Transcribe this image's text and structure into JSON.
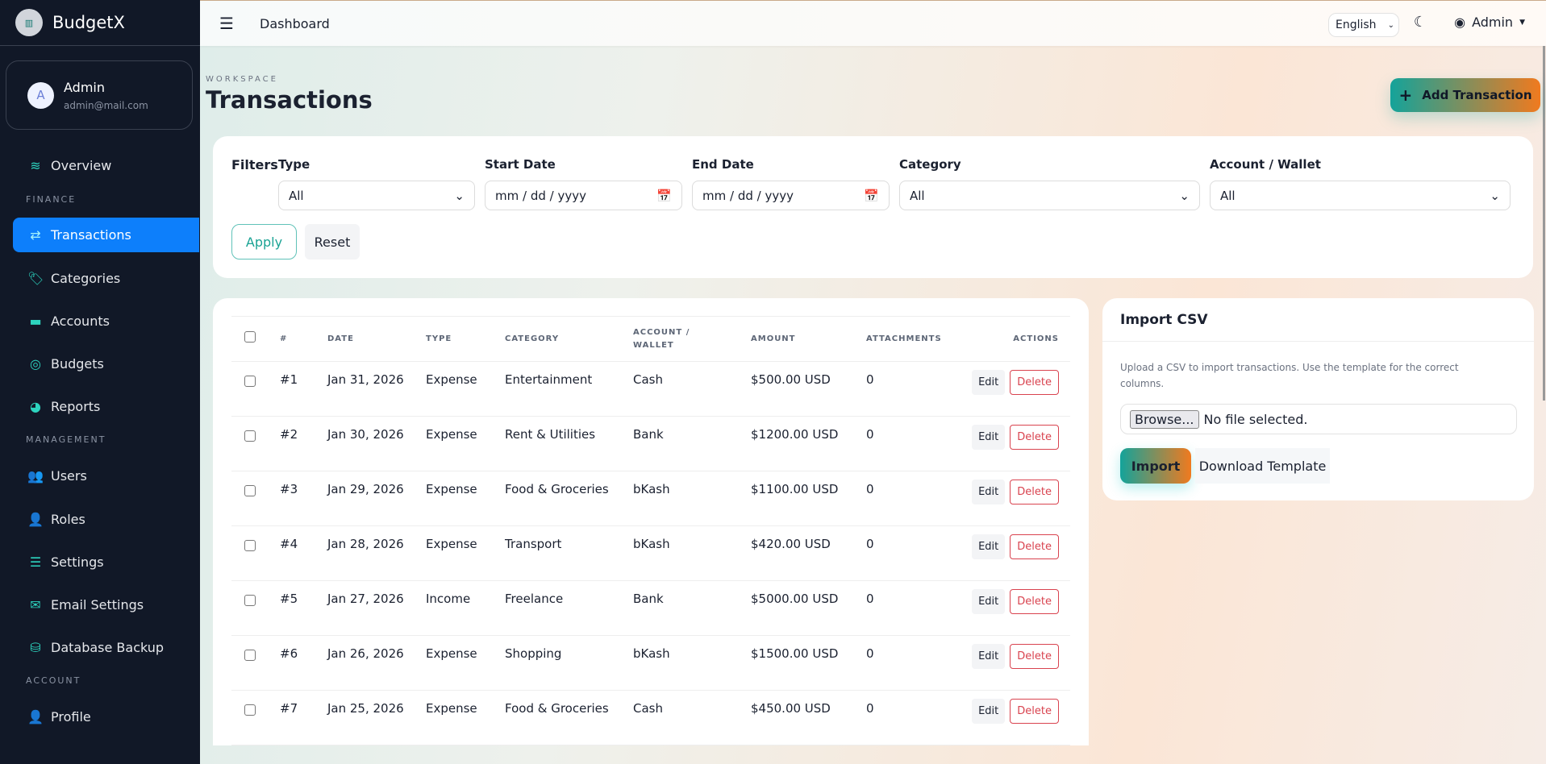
{
  "brand": {
    "name": "BudgetX",
    "logo_text": "BudgetX"
  },
  "profile": {
    "initial": "A",
    "name": "Admin",
    "email": "admin@mail.com"
  },
  "sidebar": {
    "sections": [
      "FINANCE",
      "MANAGEMENT",
      "ACCOUNT"
    ],
    "items": [
      {
        "label": "Overview",
        "icon": "layers-icon"
      },
      {
        "label": "Transactions",
        "icon": "arrows-exchange-icon",
        "active": true
      },
      {
        "label": "Categories",
        "icon": "tags-icon"
      },
      {
        "label": "Accounts",
        "icon": "wallet-icon"
      },
      {
        "label": "Budgets",
        "icon": "target-icon"
      },
      {
        "label": "Reports",
        "icon": "pie-chart-icon"
      },
      {
        "label": "Users",
        "icon": "users-icon"
      },
      {
        "label": "Roles",
        "icon": "user-gear-icon"
      },
      {
        "label": "Settings",
        "icon": "sliders-icon"
      },
      {
        "label": "Email Settings",
        "icon": "envelope-icon"
      },
      {
        "label": "Database Backup",
        "icon": "database-icon"
      },
      {
        "label": "Profile",
        "icon": "user-gear-icon"
      }
    ]
  },
  "topbar": {
    "title": "Dashboard",
    "language": "English",
    "user": "Admin"
  },
  "page": {
    "workspace": "WORKSPACE",
    "title": "Transactions",
    "add_label": "Add Transaction"
  },
  "filters": {
    "heading": "Filters",
    "type_label": "Type",
    "type_value": "All",
    "start_label": "Start Date",
    "start_placeholder": "mm / dd / yyyy",
    "end_label": "End Date",
    "end_placeholder": "mm / dd / yyyy",
    "category_label": "Category",
    "category_value": "All",
    "account_label": "Account / Wallet",
    "account_value": "All",
    "apply": "Apply",
    "reset": "Reset"
  },
  "table": {
    "headers": [
      "#",
      "DATE",
      "TYPE",
      "CATEGORY",
      "ACCOUNT / WALLET",
      "AMOUNT",
      "ATTACHMENTS",
      "ACTIONS"
    ],
    "edit": "Edit",
    "delete": "Delete",
    "rows": [
      {
        "id": "#1",
        "date": "Jan 31, 2026",
        "type": "Expense",
        "category": "Entertainment",
        "account": "Cash",
        "amount": "$500.00 USD",
        "attachments": "0"
      },
      {
        "id": "#2",
        "date": "Jan 30, 2026",
        "type": "Expense",
        "category": "Rent & Utilities",
        "account": "Bank",
        "amount": "$1200.00 USD",
        "attachments": "0"
      },
      {
        "id": "#3",
        "date": "Jan 29, 2026",
        "type": "Expense",
        "category": "Food & Groceries",
        "account": "bKash",
        "amount": "$1100.00 USD",
        "attachments": "0"
      },
      {
        "id": "#4",
        "date": "Jan 28, 2026",
        "type": "Expense",
        "category": "Transport",
        "account": "bKash",
        "amount": "$420.00 USD",
        "attachments": "0"
      },
      {
        "id": "#5",
        "date": "Jan 27, 2026",
        "type": "Income",
        "category": "Freelance",
        "account": "Bank",
        "amount": "$5000.00 USD",
        "attachments": "0"
      },
      {
        "id": "#6",
        "date": "Jan 26, 2026",
        "type": "Expense",
        "category": "Shopping",
        "account": "bKash",
        "amount": "$1500.00 USD",
        "attachments": "0"
      },
      {
        "id": "#7",
        "date": "Jan 25, 2026",
        "type": "Expense",
        "category": "Food & Groceries",
        "account": "Cash",
        "amount": "$450.00 USD",
        "attachments": "0"
      }
    ]
  },
  "import": {
    "title": "Import CSV",
    "description": "Upload a CSV to import transactions. Use the template for the correct columns.",
    "browse": "Browse...",
    "file_status": "No file selected.",
    "import": "Import",
    "download": "Download Template"
  }
}
